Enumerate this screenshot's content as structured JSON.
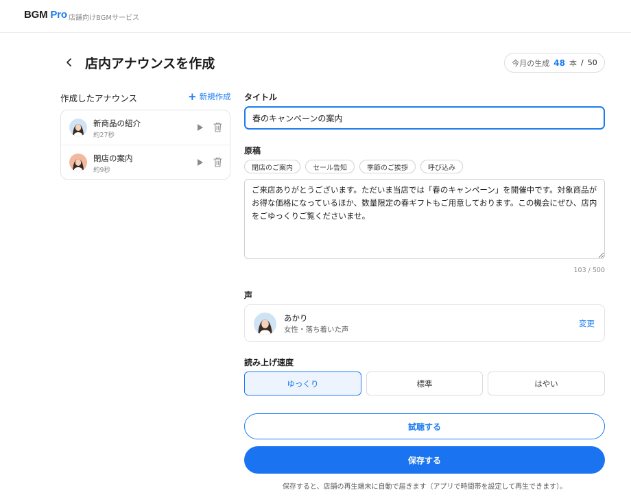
{
  "header": {
    "brand_main": "BGM",
    "brand_accent": "Pro",
    "subtitle": "店舗向けBGMサービス"
  },
  "page": {
    "title": "店内アナウンスを作成",
    "back_icon": "chevron-left-icon"
  },
  "quota": {
    "prefix": "今月の生成",
    "used": "48",
    "unit": "本",
    "separator": "/",
    "limit": "50"
  },
  "sidebar": {
    "heading": "作成したアナウンス",
    "new_label": "新規作成",
    "items": [
      {
        "name": "新商品の紹介",
        "duration": "約27秒",
        "avatar_color": "#cfe3f5"
      },
      {
        "name": "閉店の案内",
        "duration": "約9秒",
        "avatar_color": "#f2b8a0"
      }
    ]
  },
  "form": {
    "title_label": "タイトル",
    "title_value": "春のキャンペーンの案内",
    "script_label": "原稿",
    "templates": [
      "閉店のご案内",
      "セール告知",
      "季節のご挨拶",
      "呼び込み"
    ],
    "script_value": "ご来店ありがとうございます。ただいま当店では「春のキャンペーン」を開催中です。対象商品がお得な価格になっているほか、数量限定の春ギフトもご用意しております。この機会にぜひ、店内をごゆっくりご覧くださいませ。",
    "char_count": "103 / 500",
    "voice_label": "声",
    "voice": {
      "name": "あかり",
      "description": "女性・落ち着いた声",
      "change_label": "変更"
    },
    "speed_label": "読み上げ速度",
    "speed_options": [
      "ゆっくり",
      "標準",
      "はやい"
    ],
    "speed_selected": "ゆっくり",
    "preview_label": "試聴する",
    "save_label": "保存する",
    "save_note": "保存すると、店舗の再生端末に自動で届きます（アプリで時間帯を設定して再生できます）。"
  },
  "colors": {
    "accent": "#1a7cf0",
    "save_button": "#1a73f0"
  }
}
